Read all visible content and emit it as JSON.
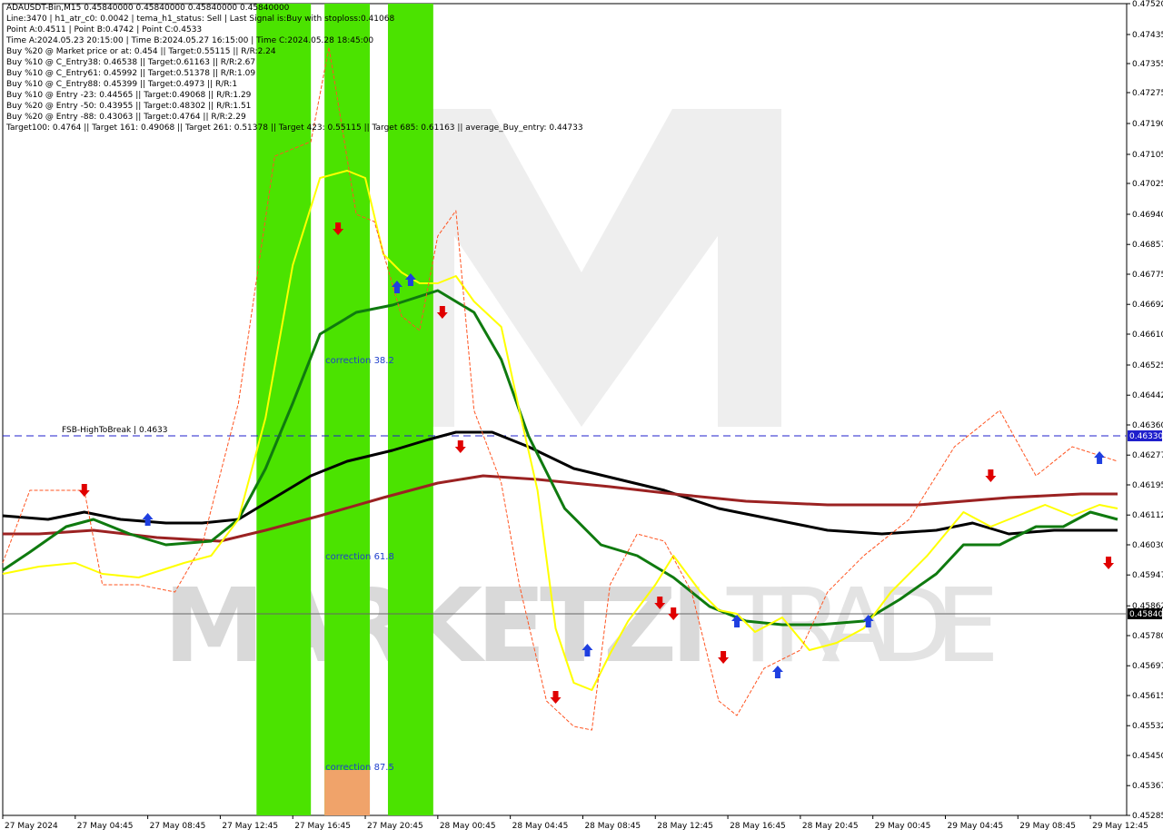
{
  "info_lines": [
    "ADAUSDT-Bin,M15  0.45840000 0.45840000 0.45840000 0.45840000",
    "Line:3470  |  h1_atr_c0: 0.0042  |  tema_h1_status: Sell  |  Last Signal is:Buy with stoploss:0.41068",
    "Point A:0.4511  |  Point B:0.4742  |  Point C:0.4533",
    "Time A:2024.05.23 20:15:00  |  Time B:2024.05.27 16:15:00  |  Time C:2024.05.28 18:45:00",
    "Buy %20 @ Market price or at: 0.454  ||  Target:0.55115  ||  R/R:2.24",
    "Buy %10 @ C_Entry38: 0.46538  ||  Target:0.61163  ||  R/R:2.67",
    "Buy %10 @ C_Entry61: 0.45992  ||  Target:0.51378  ||  R/R:1.09",
    "Buy %10 @ C_Entry88: 0.45399  ||  Target:0.4973  ||  R/R:1",
    "Buy %10 @ Entry -23: 0.44565  ||  Target:0.49068  ||  R/R:1.29",
    "Buy %20 @ Entry -50: 0.43955  ||  Target:0.48302  ||  R/R:1.51",
    "Buy %20 @ Entry -88: 0.43063  ||  Target:0.4764  ||  R/R:2.29",
    "Target100: 0.4764  ||  Target 161: 0.49068  ||  Target 261: 0.51378  ||  Target 423: 0.55115  ||  Target 685: 0.61163  ||  average_Buy_entry: 0.44733"
  ],
  "watermark": {
    "left": "MARKETZI",
    "right": "TRADE"
  },
  "chart_data": {
    "type": "line",
    "symbol": "ADAUSDT-Bin",
    "timeframe": "M15",
    "y_ticks": [
      "0.47520",
      "0.47435",
      "0.47355",
      "0.47275",
      "0.47190",
      "0.47105",
      "0.47025",
      "0.46940",
      "0.46857",
      "0.46775",
      "0.46692",
      "0.46610",
      "0.46525",
      "0.46442",
      "0.46360",
      "0.46277",
      "0.46195",
      "0.46112",
      "0.46030",
      "0.45947",
      "0.45862",
      "0.45780",
      "0.45697",
      "0.45615",
      "0.45532",
      "0.45450",
      "0.45367",
      "0.45285"
    ],
    "ylim": [
      0.45285,
      0.4752
    ],
    "x_ticks": [
      "27 May 2024",
      "27 May 04:45",
      "27 May 08:45",
      "27 May 12:45",
      "27 May 16:45",
      "27 May 20:45",
      "28 May 00:45",
      "28 May 04:45",
      "28 May 08:45",
      "28 May 12:45",
      "28 May 16:45",
      "28 May 20:45",
      "29 May 00:45",
      "29 May 04:45",
      "29 May 08:45",
      "29 May 12:45"
    ],
    "n_bars": 248,
    "xlim": [
      0,
      248
    ],
    "x_tick_bars": [
      0,
      16,
      32,
      48,
      64,
      80,
      96,
      112,
      128,
      144,
      160,
      176,
      192,
      208,
      224,
      240
    ],
    "price_labels": [
      {
        "text": "0.46330",
        "value": 0.4633,
        "bg": "#1f1fcc"
      },
      {
        "text": "0.45840",
        "value": 0.4584,
        "bg": "#000000"
      }
    ],
    "hlines": [
      {
        "value": 0.4633,
        "color": "#1f1fcc",
        "label": "FSB-HighToBreak  |  0.4633",
        "style": "dashed"
      },
      {
        "value": 0.4584,
        "color": "#666666",
        "style": "solid"
      }
    ],
    "zones": [
      {
        "from_bar": 56,
        "to_bar": 68,
        "color": "#4be300"
      },
      {
        "from_bar": 71,
        "to_bar": 81,
        "color": "#4be300"
      },
      {
        "from_bar": 85,
        "to_bar": 95,
        "color": "#4be300"
      }
    ],
    "correction_labels": [
      {
        "text": "correction 38.2",
        "value": 0.4653
      },
      {
        "text": "correction 61.8",
        "value": 0.4599
      },
      {
        "text": "correction 87.5",
        "value": 0.4541
      }
    ],
    "correction_87_box": {
      "from_bar": 71,
      "to_bar": 81,
      "low": 0.45285,
      "high": 0.4541,
      "color": "#f0a36a"
    },
    "series": [
      {
        "color": "#000000",
        "width": 3,
        "points": [
          [
            0,
            0.4611
          ],
          [
            10,
            0.461
          ],
          [
            18,
            0.4612
          ],
          [
            26,
            0.461
          ],
          [
            36,
            0.4609
          ],
          [
            44,
            0.4609
          ],
          [
            52,
            0.461
          ],
          [
            60,
            0.4616
          ],
          [
            68,
            0.4622
          ],
          [
            76,
            0.4626
          ],
          [
            86,
            0.4629
          ],
          [
            94,
            0.4632
          ],
          [
            100,
            0.4634
          ],
          [
            108,
            0.4634
          ],
          [
            116,
            0.463
          ],
          [
            126,
            0.4624
          ],
          [
            136,
            0.4621
          ],
          [
            146,
            0.4618
          ],
          [
            158,
            0.4613
          ],
          [
            170,
            0.461
          ],
          [
            182,
            0.4607
          ],
          [
            194,
            0.4606
          ],
          [
            206,
            0.4607
          ],
          [
            214,
            0.4609
          ],
          [
            222,
            0.4606
          ],
          [
            232,
            0.4607
          ],
          [
            242,
            0.4607
          ],
          [
            246,
            0.4607
          ]
        ]
      },
      {
        "color": "#9b2222",
        "width": 3,
        "points": [
          [
            0,
            0.4606
          ],
          [
            8,
            0.4606
          ],
          [
            20,
            0.4607
          ],
          [
            34,
            0.4605
          ],
          [
            48,
            0.4604
          ],
          [
            58,
            0.4607
          ],
          [
            70,
            0.4611
          ],
          [
            84,
            0.4616
          ],
          [
            96,
            0.462
          ],
          [
            106,
            0.4622
          ],
          [
            118,
            0.4621
          ],
          [
            134,
            0.4619
          ],
          [
            148,
            0.4617
          ],
          [
            164,
            0.4615
          ],
          [
            182,
            0.4614
          ],
          [
            202,
            0.4614
          ],
          [
            222,
            0.4616
          ],
          [
            238,
            0.4617
          ],
          [
            246,
            0.4617
          ]
        ]
      },
      {
        "color": "#0f7a0f",
        "width": 3,
        "points": [
          [
            0,
            0.4596
          ],
          [
            6,
            0.4601
          ],
          [
            14,
            0.4608
          ],
          [
            20,
            0.461
          ],
          [
            28,
            0.4606
          ],
          [
            36,
            0.4603
          ],
          [
            46,
            0.4604
          ],
          [
            52,
            0.461
          ],
          [
            58,
            0.4624
          ],
          [
            64,
            0.4642
          ],
          [
            70,
            0.4661
          ],
          [
            78,
            0.4667
          ],
          [
            86,
            0.4669
          ],
          [
            96,
            0.4673
          ],
          [
            104,
            0.4667
          ],
          [
            110,
            0.4654
          ],
          [
            116,
            0.4633
          ],
          [
            124,
            0.4613
          ],
          [
            132,
            0.4603
          ],
          [
            140,
            0.46
          ],
          [
            148,
            0.4594
          ],
          [
            156,
            0.4586
          ],
          [
            164,
            0.4582
          ],
          [
            172,
            0.4581
          ],
          [
            180,
            0.4581
          ],
          [
            190,
            0.4582
          ],
          [
            198,
            0.4588
          ],
          [
            206,
            0.4595
          ],
          [
            212,
            0.4603
          ],
          [
            220,
            0.4603
          ],
          [
            228,
            0.4608
          ],
          [
            234,
            0.4608
          ],
          [
            240,
            0.4612
          ],
          [
            246,
            0.461
          ]
        ]
      },
      {
        "color": "#ffff00",
        "width": 2,
        "points": [
          [
            0,
            0.4595
          ],
          [
            8,
            0.4597
          ],
          [
            16,
            0.4598
          ],
          [
            22,
            0.4595
          ],
          [
            30,
            0.4594
          ],
          [
            40,
            0.4598
          ],
          [
            46,
            0.46
          ],
          [
            52,
            0.461
          ],
          [
            58,
            0.4638
          ],
          [
            64,
            0.468
          ],
          [
            70,
            0.4704
          ],
          [
            76,
            0.4706
          ],
          [
            80,
            0.4704
          ],
          [
            84,
            0.4683
          ],
          [
            88,
            0.4678
          ],
          [
            92,
            0.4675
          ],
          [
            96,
            0.4675
          ],
          [
            100,
            0.4677
          ],
          [
            104,
            0.467
          ],
          [
            110,
            0.4663
          ],
          [
            114,
            0.464
          ],
          [
            118,
            0.4618
          ],
          [
            122,
            0.458
          ],
          [
            126,
            0.4565
          ],
          [
            130,
            0.4563
          ],
          [
            134,
            0.4573
          ],
          [
            138,
            0.4582
          ],
          [
            144,
            0.4592
          ],
          [
            148,
            0.46
          ],
          [
            154,
            0.459
          ],
          [
            158,
            0.4585
          ],
          [
            162,
            0.4584
          ],
          [
            166,
            0.4579
          ],
          [
            172,
            0.4583
          ],
          [
            178,
            0.4574
          ],
          [
            184,
            0.4576
          ],
          [
            190,
            0.458
          ],
          [
            196,
            0.459
          ],
          [
            204,
            0.46
          ],
          [
            212,
            0.4612
          ],
          [
            218,
            0.4608
          ],
          [
            224,
            0.4611
          ],
          [
            230,
            0.4614
          ],
          [
            236,
            0.4611
          ],
          [
            242,
            0.4614
          ],
          [
            246,
            0.4613
          ]
        ]
      },
      {
        "color": "#ff5522",
        "width": 1,
        "dashed": true,
        "points": [
          [
            0,
            0.4598
          ],
          [
            6,
            0.4618
          ],
          [
            18,
            0.4618
          ],
          [
            22,
            0.4592
          ],
          [
            30,
            0.4592
          ],
          [
            38,
            0.459
          ],
          [
            44,
            0.4603
          ],
          [
            52,
            0.4642
          ],
          [
            60,
            0.471
          ],
          [
            68,
            0.4714
          ],
          [
            72,
            0.474
          ],
          [
            78,
            0.4694
          ],
          [
            82,
            0.4692
          ],
          [
            88,
            0.4666
          ],
          [
            92,
            0.4662
          ],
          [
            96,
            0.4688
          ],
          [
            100,
            0.4695
          ],
          [
            104,
            0.464
          ],
          [
            110,
            0.462
          ],
          [
            114,
            0.4592
          ],
          [
            120,
            0.456
          ],
          [
            126,
            0.4553
          ],
          [
            130,
            0.4552
          ],
          [
            134,
            0.4592
          ],
          [
            140,
            0.4606
          ],
          [
            146,
            0.4604
          ],
          [
            152,
            0.459
          ],
          [
            158,
            0.456
          ],
          [
            162,
            0.4556
          ],
          [
            168,
            0.4569
          ],
          [
            176,
            0.4574
          ],
          [
            182,
            0.459
          ],
          [
            190,
            0.46
          ],
          [
            200,
            0.461
          ],
          [
            210,
            0.463
          ],
          [
            220,
            0.464
          ],
          [
            228,
            0.4622
          ],
          [
            236,
            0.463
          ],
          [
            246,
            0.4626
          ]
        ]
      }
    ],
    "signals": [
      {
        "bar": 18,
        "value": 0.4618,
        "dir": "down",
        "color": "#e00000"
      },
      {
        "bar": 32,
        "value": 0.461,
        "dir": "up",
        "color": "#1f3fe0"
      },
      {
        "bar": 74,
        "value": 0.469,
        "dir": "down",
        "color": "#e00000"
      },
      {
        "bar": 87,
        "value": 0.4674,
        "dir": "up",
        "color": "#1f3fe0"
      },
      {
        "bar": 90,
        "value": 0.4676,
        "dir": "up",
        "color": "#1f3fe0"
      },
      {
        "bar": 97,
        "value": 0.4667,
        "dir": "down",
        "color": "#e00000"
      },
      {
        "bar": 101,
        "value": 0.463,
        "dir": "down",
        "color": "#e00000"
      },
      {
        "bar": 122,
        "value": 0.4561,
        "dir": "down",
        "color": "#e00000"
      },
      {
        "bar": 129,
        "value": 0.4574,
        "dir": "up",
        "color": "#1f3fe0"
      },
      {
        "bar": 145,
        "value": 0.4587,
        "dir": "down",
        "color": "#e00000"
      },
      {
        "bar": 148,
        "value": 0.4584,
        "dir": "down",
        "color": "#e00000"
      },
      {
        "bar": 159,
        "value": 0.4572,
        "dir": "down",
        "color": "#e00000"
      },
      {
        "bar": 162,
        "value": 0.4582,
        "dir": "up",
        "color": "#1f3fe0"
      },
      {
        "bar": 171,
        "value": 0.4568,
        "dir": "up",
        "color": "#1f3fe0"
      },
      {
        "bar": 191,
        "value": 0.4582,
        "dir": "up",
        "color": "#1f3fe0"
      },
      {
        "bar": 218,
        "value": 0.4622,
        "dir": "down",
        "color": "#e00000"
      },
      {
        "bar": 242,
        "value": 0.4627,
        "dir": "up",
        "color": "#1f3fe0"
      },
      {
        "bar": 244,
        "value": 0.4598,
        "dir": "down",
        "color": "#e00000"
      }
    ]
  }
}
